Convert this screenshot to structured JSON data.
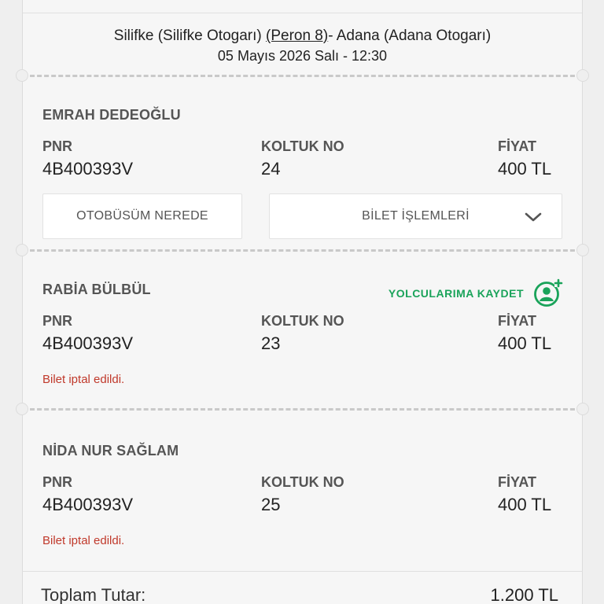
{
  "trip": {
    "origin": "Silifke (Silifke Otogarı)",
    "platform": "(Peron 8)",
    "destination": "- Adana (Adana Otogarı)",
    "datetime": "05 Mayıs 2026 Salı - 12:30"
  },
  "labels": {
    "pnr": "PNR",
    "seat": "KOLTUK NO",
    "price": "FİYAT"
  },
  "tickets": [
    {
      "name": "EMRAH DEDEOĞLU",
      "pnr": "4B400393V",
      "seat": "24",
      "price": "400 TL",
      "bus_button": "OTOBÜSÜM NEREDE",
      "actions_button": "BİLET İŞLEMLERİ"
    },
    {
      "name": "RABİA BÜLBÜL",
      "pnr": "4B400393V",
      "seat": "23",
      "price": "400 TL",
      "save_label": "YOLCULARIMA KAYDET",
      "status": "Bilet iptal edildi."
    },
    {
      "name": "NİDA NUR SAĞLAM",
      "pnr": "4B400393V",
      "seat": "25",
      "price": "400 TL",
      "status": "Bilet iptal edildi."
    }
  ],
  "total": {
    "label": "Toplam Tutar:",
    "value": "1.200 TL"
  },
  "colors": {
    "accent_green": "#1aa35a",
    "cancel_red": "#c0392b"
  }
}
